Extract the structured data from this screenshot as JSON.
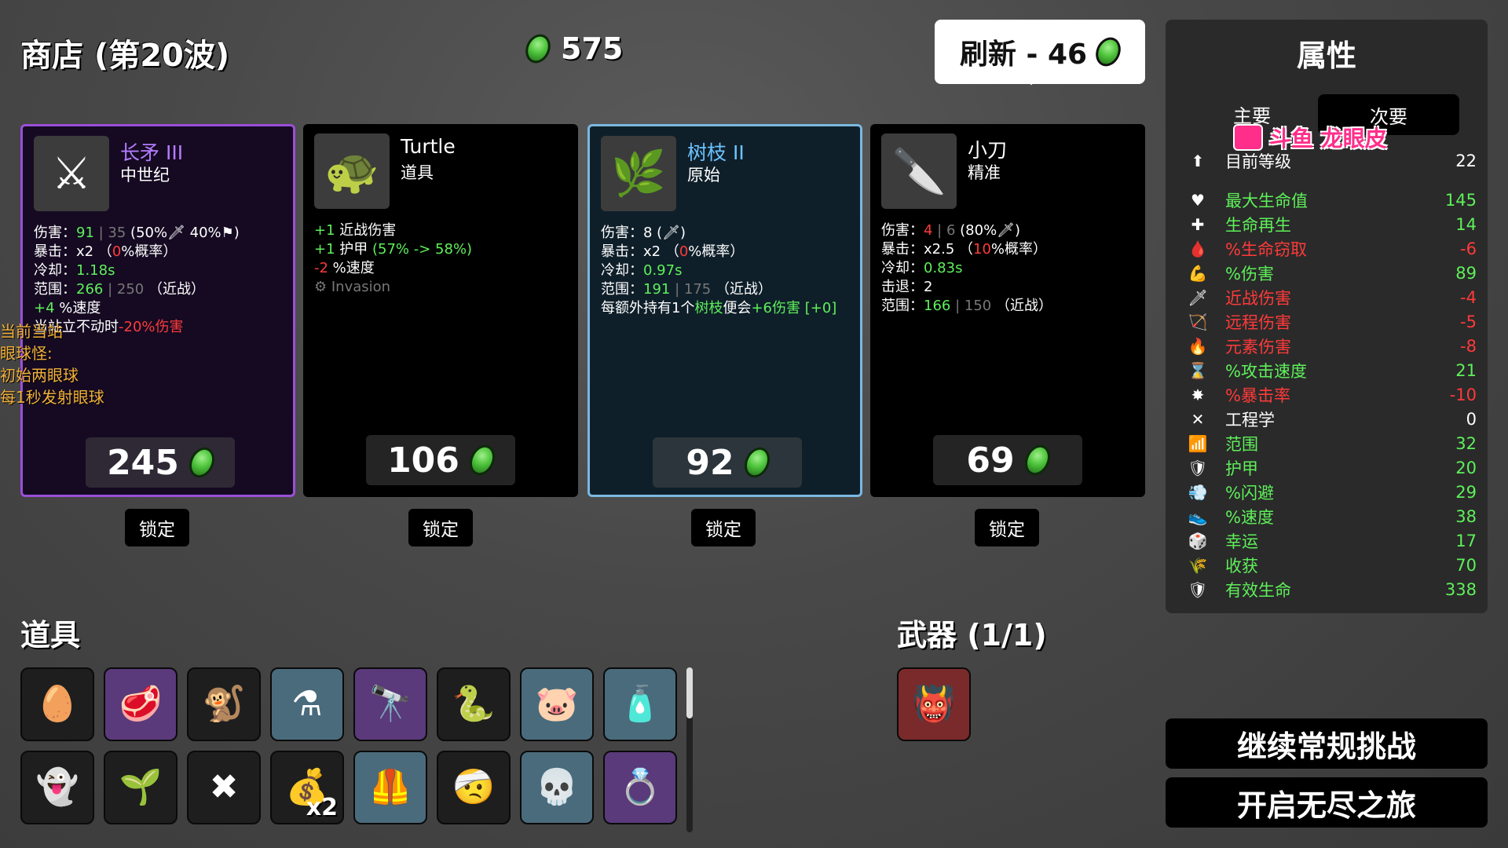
{
  "header": {
    "shop_title": "商店 (第20波)",
    "gold_amount": "575",
    "refresh_label": "刷新 - 46"
  },
  "cards": [
    {
      "name": "长矛 III",
      "type": "中世纪",
      "icon": "spear-icon",
      "lines": [
        {
          "label": "伤害：",
          "parts": [
            [
              "g",
              "91"
            ],
            [
              "dim",
              " | 35 "
            ],
            [
              "w",
              "(50%🗡 40%⚑)"
            ]
          ]
        },
        {
          "label": "暴击：",
          "parts": [
            [
              "w",
              "x2 （"
            ],
            [
              "r",
              "0"
            ],
            [
              "w",
              "%概率）"
            ]
          ]
        },
        {
          "label": "冷却：",
          "parts": [
            [
              "g",
              "1.18s"
            ]
          ]
        },
        {
          "label": "范围：",
          "parts": [
            [
              "g",
              "266"
            ],
            [
              "dim",
              " | 250 "
            ],
            [
              "w",
              " （近战）"
            ]
          ]
        },
        {
          "label": "",
          "parts": [
            [
              "g",
              "+4"
            ],
            [
              "w",
              " %速度"
            ]
          ]
        },
        {
          "label": "",
          "parts": [
            [
              "w",
              "当站立不动时"
            ],
            [
              "r",
              "-20%伤害"
            ]
          ]
        }
      ],
      "price": "245",
      "lock": "锁定"
    },
    {
      "name": "Turtle",
      "type": "道具",
      "icon": "turtle-icon",
      "lines": [
        {
          "label": "",
          "parts": [
            [
              "g",
              "+1"
            ],
            [
              "w",
              " 近战伤害"
            ]
          ]
        },
        {
          "label": "",
          "parts": [
            [
              "g",
              "+1"
            ],
            [
              "w",
              " 护甲 "
            ],
            [
              "g",
              "(57% -> 58%)"
            ]
          ]
        },
        {
          "label": "",
          "parts": [
            [
              "r",
              "-2"
            ],
            [
              "w",
              " %速度"
            ]
          ]
        },
        {
          "label": "",
          "parts": [
            [
              "dim",
              "⚙ Invasion"
            ]
          ]
        }
      ],
      "price": "106",
      "lock": "锁定"
    },
    {
      "name": "树枝 II",
      "type": "原始",
      "icon": "branch-icon",
      "lines": [
        {
          "label": "伤害：",
          "parts": [
            [
              "w",
              "8 (🗡)"
            ]
          ]
        },
        {
          "label": "暴击：",
          "parts": [
            [
              "w",
              "x2 （"
            ],
            [
              "r",
              "0"
            ],
            [
              "w",
              "%概率）"
            ]
          ]
        },
        {
          "label": "冷却：",
          "parts": [
            [
              "g",
              "0.97s"
            ]
          ]
        },
        {
          "label": "范围：",
          "parts": [
            [
              "g",
              "191"
            ],
            [
              "dim",
              " | 175 "
            ],
            [
              "w",
              " （近战）"
            ]
          ]
        },
        {
          "label": "",
          "parts": [
            [
              "w",
              "每额外持有1个"
            ],
            [
              "g",
              "树枝"
            ],
            [
              "w",
              "便会"
            ],
            [
              "g",
              "+6伤害"
            ],
            [
              "w",
              " "
            ],
            [
              "g",
              "[+0]"
            ]
          ]
        }
      ],
      "price": "92",
      "lock": "锁定"
    },
    {
      "name": "小刀",
      "type": "精准",
      "icon": "knife-icon",
      "lines": [
        {
          "label": "伤害：",
          "parts": [
            [
              "r",
              "4"
            ],
            [
              "dim",
              " | 6 "
            ],
            [
              "w",
              "(80%🗡)"
            ]
          ]
        },
        {
          "label": "暴击：",
          "parts": [
            [
              "w",
              "x2.5 （"
            ],
            [
              "r",
              "10"
            ],
            [
              "w",
              "%概率）"
            ]
          ]
        },
        {
          "label": "冷却：",
          "parts": [
            [
              "g",
              "0.83s"
            ]
          ]
        },
        {
          "label": "击退：",
          "parts": [
            [
              "w",
              "2"
            ]
          ]
        },
        {
          "label": "范围：",
          "parts": [
            [
              "g",
              "166"
            ],
            [
              "dim",
              " | 150 "
            ],
            [
              "w",
              " （近战）"
            ]
          ]
        }
      ],
      "price": "69",
      "lock": "锁定"
    }
  ],
  "overlay_text": [
    "当前当站",
    "眼球怪:",
    "初始两眼球",
    "每1秒发射眼球"
  ],
  "items_section": {
    "title": "道具",
    "slots": [
      {
        "icon": "egg-icon",
        "glyph": "🥚",
        "rarity": "normal"
      },
      {
        "icon": "meat-icon",
        "glyph": "🥩",
        "rarity": "epic"
      },
      {
        "icon": "monkey-icon",
        "glyph": "🐒",
        "rarity": "normal"
      },
      {
        "icon": "potion-icon",
        "glyph": "⚗",
        "rarity": "rare"
      },
      {
        "icon": "cannon-icon",
        "glyph": "🔭",
        "rarity": "epic"
      },
      {
        "icon": "snake-icon",
        "glyph": "🐍",
        "rarity": "normal"
      },
      {
        "icon": "blob-icon",
        "glyph": "🐷",
        "rarity": "rare"
      },
      {
        "icon": "bottle-icon",
        "glyph": "🧴",
        "rarity": "rare"
      },
      {
        "icon": "ghost-icon",
        "glyph": "👻",
        "rarity": "normal"
      },
      {
        "icon": "sprout-icon",
        "glyph": "🌱",
        "rarity": "normal"
      },
      {
        "icon": "thorn-icon",
        "glyph": "✖",
        "rarity": "normal"
      },
      {
        "icon": "bag-icon",
        "glyph": "💰",
        "rarity": "normal",
        "qty": "x2"
      },
      {
        "icon": "vest-icon",
        "glyph": "🦺",
        "rarity": "rare"
      },
      {
        "icon": "bandage-icon",
        "glyph": "🤕",
        "rarity": "normal"
      },
      {
        "icon": "skull-icon",
        "glyph": "💀",
        "rarity": "rare"
      },
      {
        "icon": "ring-icon",
        "glyph": "💍",
        "rarity": "epic"
      }
    ]
  },
  "weapons_section": {
    "title": "武器 (1/1)",
    "slots": [
      {
        "icon": "monster-weapon-icon",
        "glyph": "👹",
        "rarity": "legend"
      }
    ]
  },
  "stats": {
    "title": "属性",
    "tab_main": "主要",
    "tab_secondary": "次要",
    "watermark": "斗鱼 龙眼皮",
    "rows": [
      {
        "icon": "level-icon",
        "glyph": "⬆",
        "label": "目前等级",
        "value": "22",
        "color": "#ffffff"
      },
      {
        "icon": "heart-icon",
        "glyph": "♥",
        "label": "最大生命值",
        "value": "145",
        "color": "#5ef05a"
      },
      {
        "icon": "regen-icon",
        "glyph": "✚",
        "label": "生命再生",
        "value": "14",
        "color": "#5ef05a"
      },
      {
        "icon": "lifesteal-icon",
        "glyph": "🩸",
        "label": "%生命窃取",
        "value": "-6",
        "color": "#ff3a3a"
      },
      {
        "icon": "damage-icon",
        "glyph": "💪",
        "label": "%伤害",
        "value": "89",
        "color": "#5ef05a"
      },
      {
        "icon": "melee-icon",
        "glyph": "🗡",
        "label": "近战伤害",
        "value": "-4",
        "color": "#ff3a3a"
      },
      {
        "icon": "ranged-icon",
        "glyph": "🏹",
        "label": "远程伤害",
        "value": "-5",
        "color": "#ff3a3a"
      },
      {
        "icon": "elemental-icon",
        "glyph": "🔥",
        "label": "元素伤害",
        "value": "-8",
        "color": "#ff3a3a"
      },
      {
        "icon": "attack-speed-icon",
        "glyph": "⌛",
        "label": "%攻击速度",
        "value": "21",
        "color": "#5ef05a"
      },
      {
        "icon": "crit-icon",
        "glyph": "✸",
        "label": "%暴击率",
        "value": "-10",
        "color": "#ff3a3a"
      },
      {
        "icon": "engineering-icon",
        "glyph": "✕",
        "label": "工程学",
        "value": "0",
        "color": "#ffffff"
      },
      {
        "icon": "range-icon",
        "glyph": "📶",
        "label": "范围",
        "value": "32",
        "color": "#5ef05a"
      },
      {
        "icon": "armor-icon",
        "glyph": "🛡",
        "label": "护甲",
        "value": "20",
        "color": "#5ef05a"
      },
      {
        "icon": "dodge-icon",
        "glyph": "💨",
        "label": "%闪避",
        "value": "29",
        "color": "#5ef05a"
      },
      {
        "icon": "speed-icon",
        "glyph": "👟",
        "label": "%速度",
        "value": "38",
        "color": "#5ef05a"
      },
      {
        "icon": "luck-icon",
        "glyph": "🎲",
        "label": "幸运",
        "value": "17",
        "color": "#5ef05a"
      },
      {
        "icon": "harvest-icon",
        "glyph": "🌾",
        "label": "收获",
        "value": "70",
        "color": "#5ef05a"
      },
      {
        "icon": "effective-hp-icon",
        "glyph": "🛡",
        "label": "有效生命",
        "value": "338",
        "color": "#5ef05a"
      }
    ]
  },
  "buttons": {
    "continue": "继续常规挑战",
    "endless": "开启无尽之旅"
  }
}
